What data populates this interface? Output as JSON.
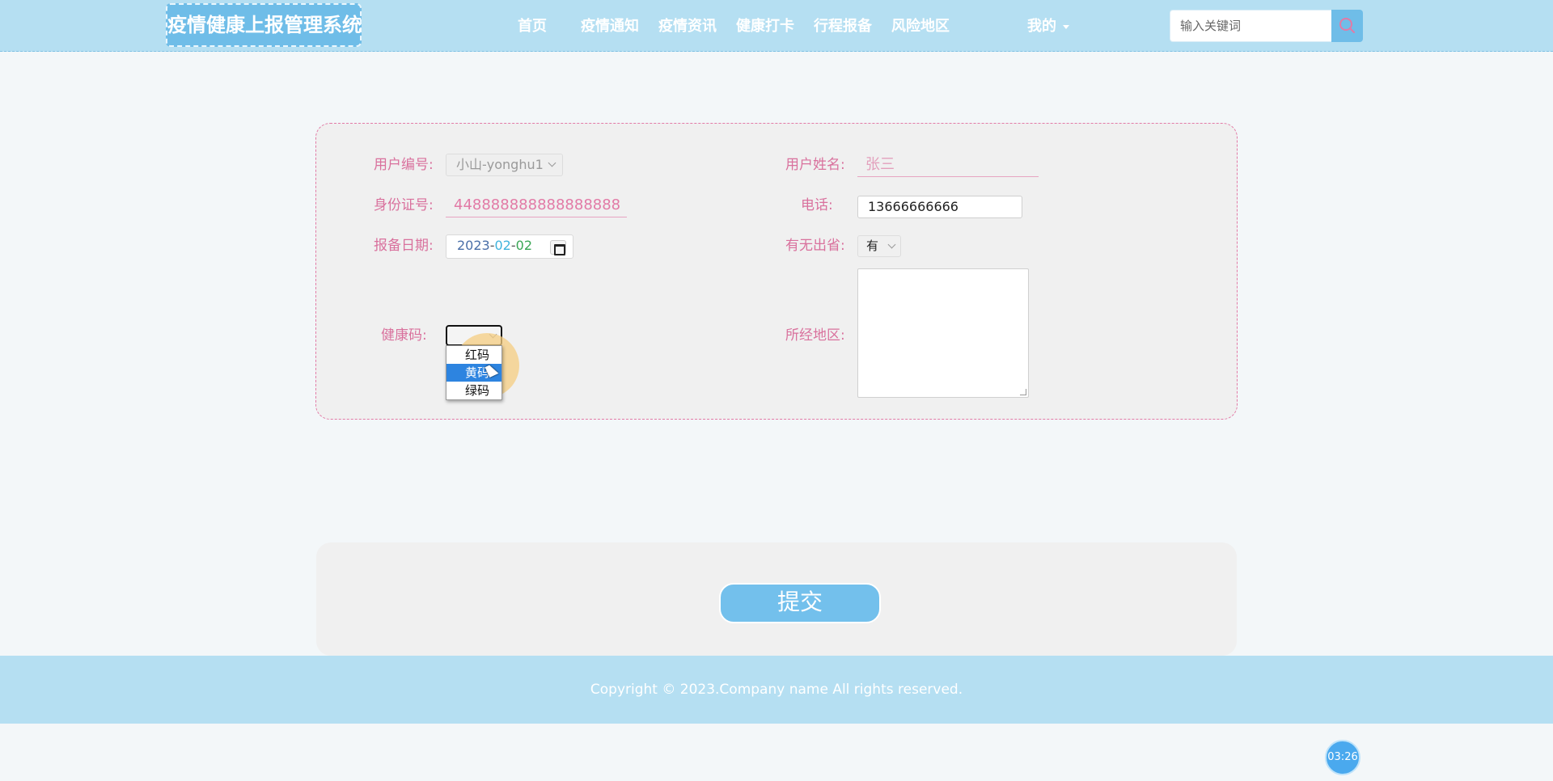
{
  "header": {
    "logo": "疫情健康上报管理系统",
    "nav": [
      "首页",
      "疫情通知",
      "疫情资讯",
      "健康打卡",
      "行程报备",
      "风险地区"
    ],
    "my": "我的",
    "search_placeholder": "输入关键词",
    "search_icon": "search-icon"
  },
  "form": {
    "user_no_label": "用户编号:",
    "user_no_value": "小山-yonghu1",
    "user_name_label": "用户姓名:",
    "user_name_value": "张三",
    "id_label": "身份证号:",
    "id_value": "448888888888888888",
    "phone_label": "电话:",
    "phone_value": "13666666666",
    "date_label": "报备日期:",
    "date_year": "2023",
    "date_month": "02",
    "date_day": "02",
    "out_province_label": "有无出省:",
    "out_province_value": "有",
    "health_code_label": "健康码:",
    "health_code_options": [
      "红码",
      "黄码",
      "绿码"
    ],
    "regions_label": "所经地区:"
  },
  "submit_label": "提交",
  "footer": {
    "copyright": "Copyright © 2023.Company name All rights reserved."
  },
  "clock": "03:26",
  "colors": {
    "header_bg": "#b5dff2",
    "accent_blue": "#6fbde8",
    "label_pink": "#d9719d",
    "selected_option": "#2d84e0"
  }
}
